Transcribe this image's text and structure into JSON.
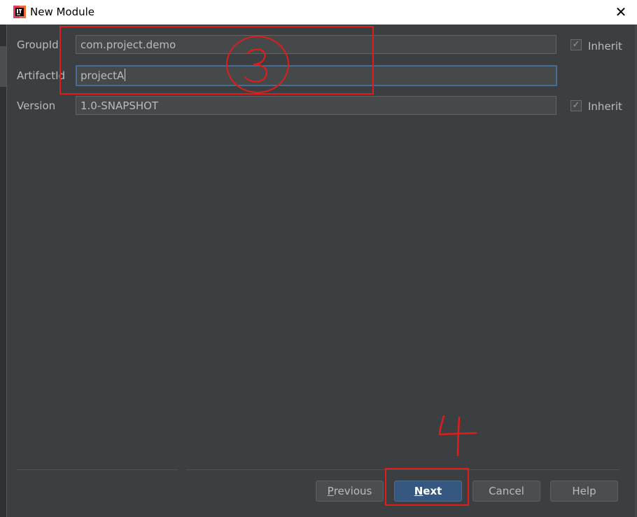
{
  "window": {
    "title": "New Module",
    "icon": "intellij-icon",
    "close_glyph": "✕"
  },
  "form": {
    "groupid": {
      "label": "GroupId",
      "value": "com.project.demo",
      "inherit_label": "Inherit",
      "inherit_checked": true
    },
    "artifactid": {
      "label": "ArtifactId",
      "value": "projectA"
    },
    "version": {
      "label": "Version",
      "value": "1.0-SNAPSHOT",
      "inherit_label": "Inherit",
      "inherit_checked": true
    }
  },
  "buttons": {
    "previous": {
      "mnemonic": "P",
      "rest": "revious"
    },
    "next": {
      "mnemonic": "N",
      "rest": "ext"
    },
    "cancel": "Cancel",
    "help": "Help"
  },
  "annotations": {
    "step3": "3",
    "step4": "4",
    "color": "#e01d1d"
  },
  "colors": {
    "background": "#3c3f41",
    "field": "#45494a",
    "text": "#bbbbbb",
    "default_button": "#365880"
  }
}
